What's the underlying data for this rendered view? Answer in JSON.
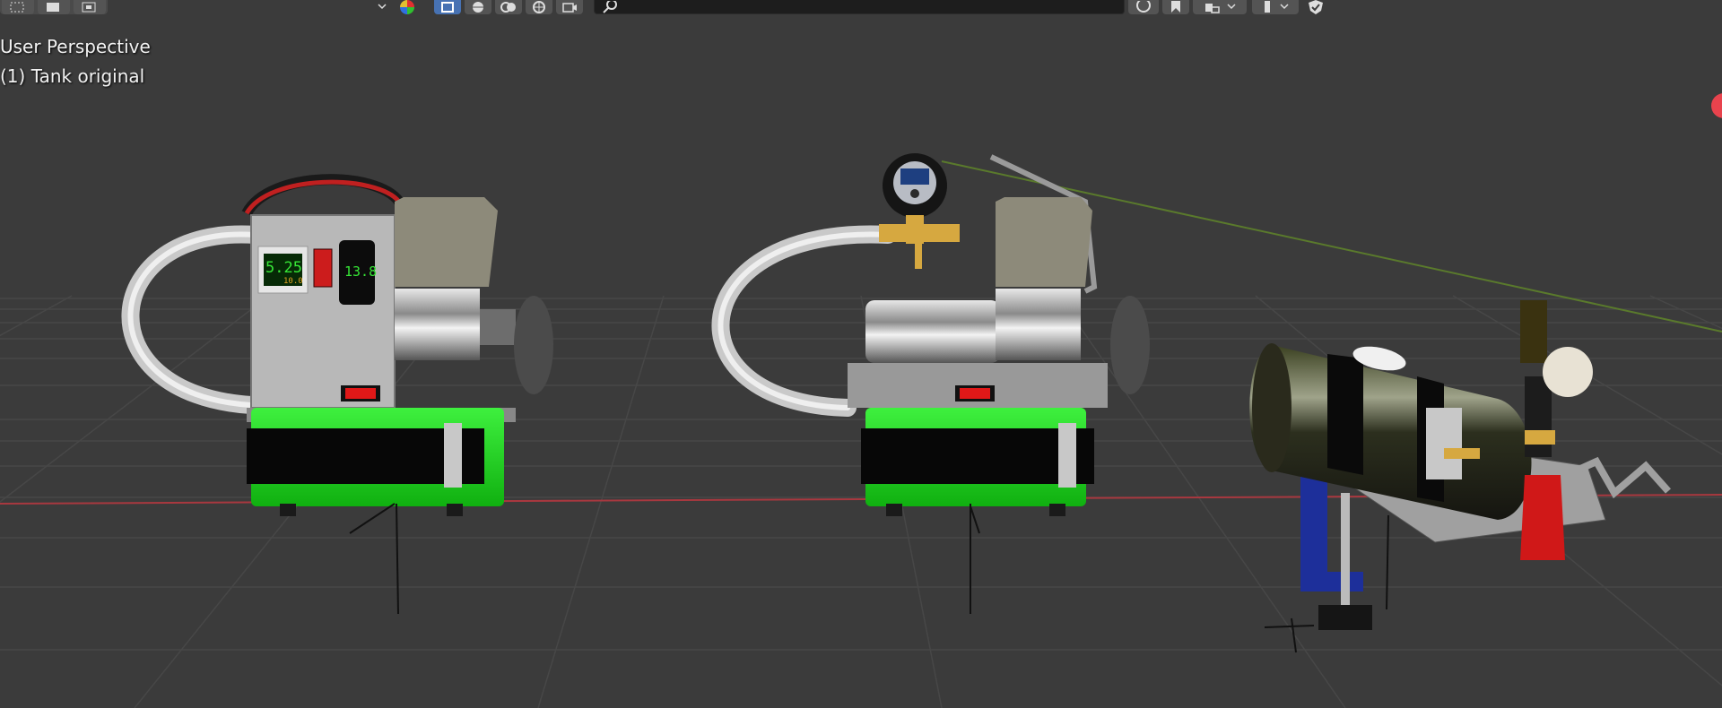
{
  "viewport": {
    "view_mode": "User Perspective",
    "object_info": "(1) Tank original"
  },
  "header": {
    "search_placeholder": "",
    "icons": [
      "select-box-icon",
      "select-extend-icon",
      "select-subtract-icon",
      "chevron-down-icon",
      "color-wheel-icon",
      "object-mode-icon",
      "viewport-shading-icon",
      "overlay-icon",
      "gizmo-icon",
      "camera-icon",
      "search-icon",
      "circle-icon",
      "bookmark-icon",
      "layers-icon",
      "chevron-down-icon",
      "filter-icon",
      "chevron-down-icon",
      "shield-icon"
    ]
  },
  "colors": {
    "background": "#3b3b3b",
    "grid": "#4a4a4a",
    "x_axis": "#b03a3a",
    "y_axis": "#5b7a2a",
    "accent": "#4772b3",
    "gadget_green": "#1bd31b"
  },
  "gauges": {
    "left_display": "5.25",
    "left_display_sub": "10.0",
    "right_display": "13.8"
  }
}
